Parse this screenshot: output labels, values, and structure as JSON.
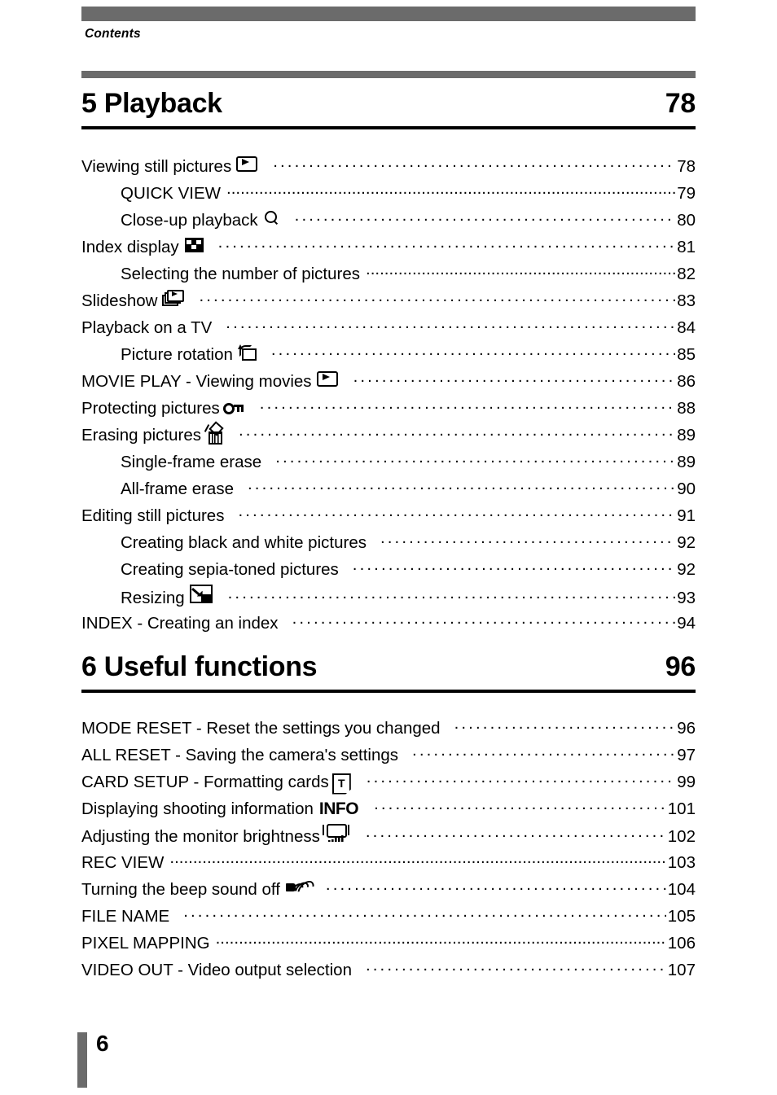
{
  "page": {
    "running_head": "Contents",
    "footer_page_number": "6",
    "accent_gray": "#6b6b6b",
    "text_color": "#000000",
    "background": "#ffffff"
  },
  "chapters": [
    {
      "title": "5 Playback",
      "page": "78",
      "entries": [
        {
          "label": "Viewing still pictures",
          "icon": "play-icon",
          "page": "78",
          "level": 1
        },
        {
          "label": "QUICK VIEW",
          "icon": "",
          "page": "79",
          "level": 2,
          "tight_leader": true
        },
        {
          "label": "Close-up playback",
          "icon": "magnifier-icon",
          "page": "80",
          "level": 2
        },
        {
          "label": "Index display",
          "icon": "index-checkerboard-icon",
          "page": "81",
          "level": 1
        },
        {
          "label": "Selecting the number of pictures",
          "icon": "",
          "page": "82",
          "level": 2,
          "tight_leader": true
        },
        {
          "label": "Slideshow",
          "icon": "slideshow-icon",
          "page": "83",
          "level": 1
        },
        {
          "label": "Playback on a TV",
          "icon": "",
          "page": "84",
          "level": 1
        },
        {
          "label": "Picture rotation",
          "icon": "rotate-icon",
          "page": "85",
          "level": 2
        },
        {
          "label": "MOVIE PLAY - Viewing movies",
          "icon": "play-icon",
          "page": "86",
          "level": 1
        },
        {
          "label": "Protecting pictures",
          "icon": "key-icon",
          "page": "88",
          "level": 1
        },
        {
          "label": "Erasing pictures",
          "icon": "trash-icon",
          "page": "89",
          "level": 1
        },
        {
          "label": "Single-frame erase",
          "icon": "",
          "page": "89",
          "level": 2
        },
        {
          "label": "All-frame erase",
          "icon": "",
          "page": "90",
          "level": 2
        },
        {
          "label": "Editing still pictures",
          "icon": "",
          "page": "91",
          "level": 1
        },
        {
          "label": "Creating black and white pictures",
          "icon": "",
          "page": "92",
          "level": 2
        },
        {
          "label": "Creating sepia-toned pictures",
          "icon": "",
          "page": "92",
          "level": 2
        },
        {
          "label": "Resizing",
          "icon": "resize-icon",
          "page": "93",
          "level": 2
        },
        {
          "label": "INDEX - Creating an index",
          "icon": "",
          "page": "94",
          "level": 1
        }
      ]
    },
    {
      "title": "6 Useful functions",
      "page": "96",
      "entries": [
        {
          "label": "MODE RESET - Reset the settings you changed",
          "icon": "",
          "page": "96",
          "level": 1
        },
        {
          "label": "ALL RESET - Saving the camera's settings",
          "icon": "",
          "page": "97",
          "level": 1
        },
        {
          "label": "CARD SETUP - Formatting cards",
          "icon": "card-setup-icon",
          "icon_text": "T",
          "page": "99",
          "level": 1
        },
        {
          "label": "Displaying shooting information",
          "icon": "info-icon",
          "icon_text": "INFO",
          "page": "101",
          "level": 1
        },
        {
          "label": "Adjusting the monitor brightness",
          "icon": "monitor-brightness-icon",
          "page": "102",
          "level": 1
        },
        {
          "label": "REC VIEW",
          "icon": "",
          "page": "103",
          "level": 1,
          "tight_leader": true
        },
        {
          "label": "Turning the beep sound off",
          "icon": "beep-sound-icon",
          "page": "104",
          "level": 1
        },
        {
          "label": "FILE NAME",
          "icon": "",
          "page": "105",
          "level": 1
        },
        {
          "label": "PIXEL MAPPING",
          "icon": "",
          "page": "106",
          "level": 1,
          "tight_leader": true
        },
        {
          "label": "VIDEO OUT - Video output selection",
          "icon": "",
          "page": "107",
          "level": 1
        }
      ]
    }
  ]
}
